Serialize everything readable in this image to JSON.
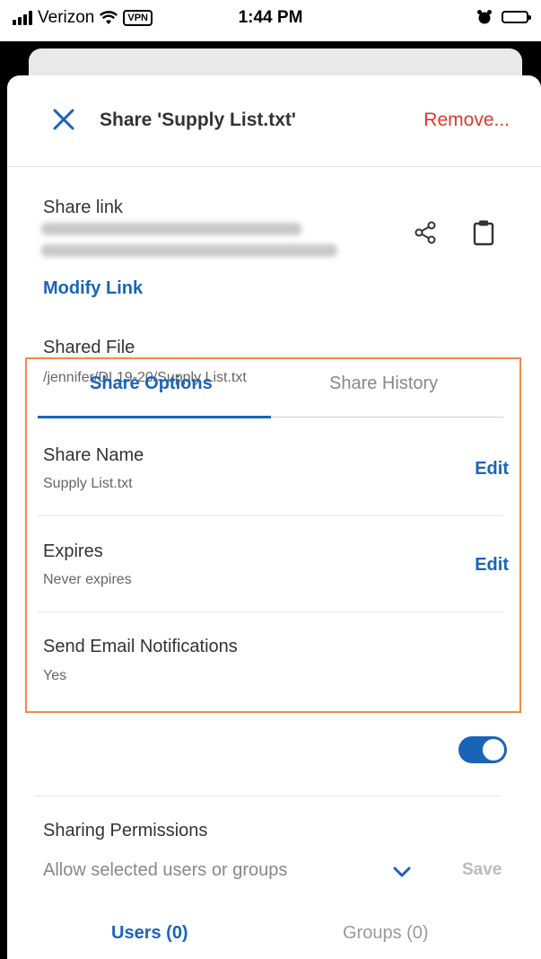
{
  "status_bar": {
    "carrier": "Verizon",
    "vpn": "VPN",
    "time": "1:44 PM"
  },
  "header": {
    "title": "Share 'Supply List.txt'",
    "remove_label": "Remove..."
  },
  "share_link": {
    "label": "Share link",
    "modify_label": "Modify Link"
  },
  "shared_file": {
    "label": "Shared File",
    "path": "/jennifer/DI 19-20/Supply List.txt"
  },
  "tabs": {
    "share_options": "Share Options",
    "share_history": "Share History"
  },
  "options": {
    "share_name_label": "Share Name",
    "share_name_value": "Supply List.txt",
    "expires_label": "Expires",
    "expires_value": "Never expires",
    "email_label": "Send Email Notifications",
    "email_value": "Yes",
    "email_enabled": true,
    "edit_label": "Edit"
  },
  "permissions": {
    "label": "Sharing Permissions",
    "selected": "Allow selected users or groups",
    "save_label": "Save",
    "users_tab": "Users (0)",
    "groups_tab": "Groups (0)"
  },
  "colors": {
    "accent": "#1a64b8",
    "danger": "#e8352c",
    "highlight": "#f08a4b"
  }
}
